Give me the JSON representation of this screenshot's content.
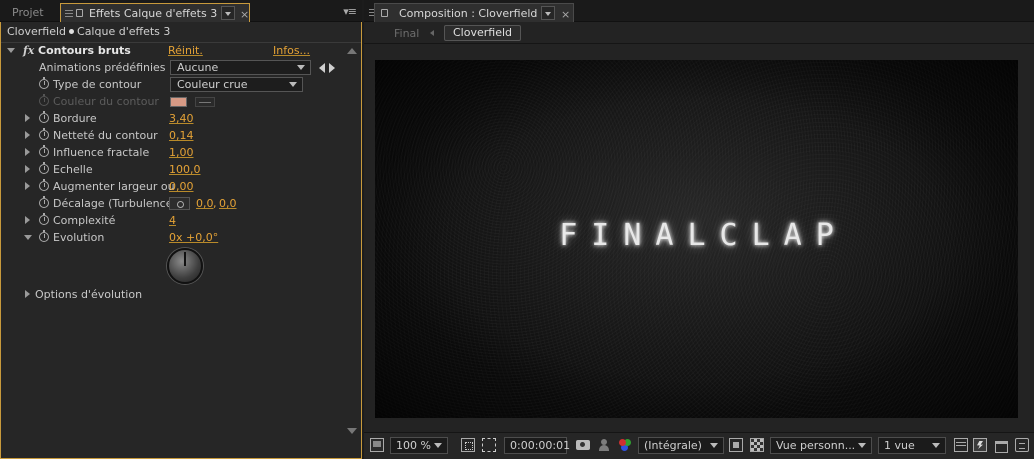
{
  "left_panel": {
    "tab_project": "Projet",
    "tab_effects": "Effets Calque d'effets 3",
    "tab_close": "×",
    "panel_menu": "▾≡",
    "breadcrumb": {
      "comp": "Cloverfield",
      "layer": "Calque d'effets 3"
    },
    "effect": {
      "fx_mark": "fx",
      "name": "Contours bruts",
      "reset": "Réinit.",
      "info": "Infos..."
    },
    "rows": {
      "presets": {
        "label": "Animations prédéfinies :",
        "value": "Aucune"
      },
      "edge_type": {
        "label": "Type de contour",
        "value": "Couleur crue"
      },
      "edge_color": {
        "label": "Couleur du contour",
        "swatch_color": "#d79a85"
      },
      "border": {
        "label": "Bordure",
        "value": "3,40"
      },
      "edge_sharpness": {
        "label": "Netteté du contour",
        "value": "0,14"
      },
      "fractal_influence": {
        "label": "Influence fractale",
        "value": "1,00"
      },
      "scale": {
        "label": "Echelle",
        "value": "100,0"
      },
      "stretch_width": {
        "label": "Augmenter largeur ou",
        "value": "0,00"
      },
      "offset": {
        "label": "Décalage (Turbulence",
        "value_x": "0,0",
        "value_sep": ",",
        "value_y": "0,0"
      },
      "complexity": {
        "label": "Complexité",
        "value": "4"
      },
      "evolution": {
        "label": "Evolution",
        "value": "0x +0,0°"
      },
      "evolution_options": {
        "label": "Options d'évolution"
      }
    }
  },
  "right_panel": {
    "tab_comp": "Composition : Cloverfield",
    "tab_close": "×",
    "subtab_final": "Final",
    "subtab_current": "Cloverfield",
    "preview_text": "FINALCLAP",
    "bottom_bar": {
      "zoom": "100 %",
      "timecode": "0:00:00:01",
      "resolution": "(Intégrale)",
      "view": "Vue personn...",
      "views_count": "1 vue"
    }
  },
  "colors": {
    "accent_orange": "#e4a236",
    "panel_border": "#c89a3c",
    "background": "#1c1c1c"
  }
}
